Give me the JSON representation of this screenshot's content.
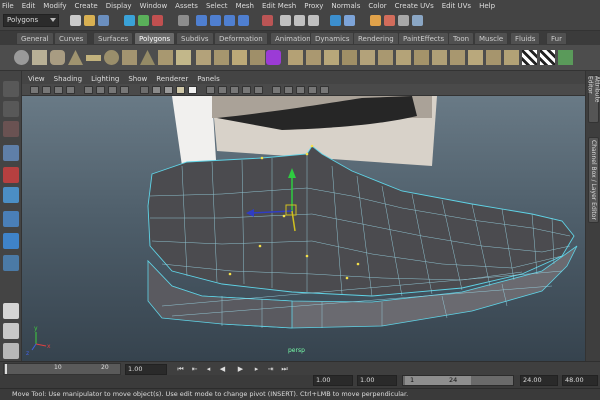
{
  "menu": [
    "File",
    "Edit",
    "Modify",
    "Create",
    "Display",
    "Window",
    "Assets",
    "Select",
    "Mesh",
    "Edit Mesh",
    "Proxy",
    "Normals",
    "Color",
    "Create UVs",
    "Edit UVs",
    "Help"
  ],
  "status_line": {
    "mode": "Polygons"
  },
  "shelf_tabs": [
    "General",
    "Curves",
    "Surfaces",
    "Polygons",
    "Subdivs",
    "Deformation",
    "Animation",
    "Dynamics",
    "Rendering",
    "PaintEffects",
    "Toon",
    "Muscle",
    "Fluids",
    "Fur"
  ],
  "active_shelf_tab": "Polygons",
  "panel_menu": [
    "View",
    "Shading",
    "Lighting",
    "Show",
    "Renderer",
    "Panels"
  ],
  "side_tabs": {
    "attribute_editor": "Attribute Editor",
    "channel_box": "Channel Box / Layer Editor"
  },
  "viewport": {
    "camera": "persp"
  },
  "time_slider": {
    "ticks": [
      "10",
      "20"
    ],
    "current_time": "1.00"
  },
  "range_slider": {
    "start_time": "1.00",
    "playback_start": "1.00",
    "range_start": "1",
    "range_end": "24",
    "playback_end": "24.00",
    "end_time": "48.00"
  },
  "help_line": "Move Tool: Use manipulator to move object(s). Use edit mode to change pivot (INSERT). Ctrl+LMB to move perpendicular.",
  "colors": {
    "wire": "#5fd3e6",
    "mesh": "#4b4b4f",
    "background_top": "#697a86",
    "background_bottom": "#36434e"
  }
}
